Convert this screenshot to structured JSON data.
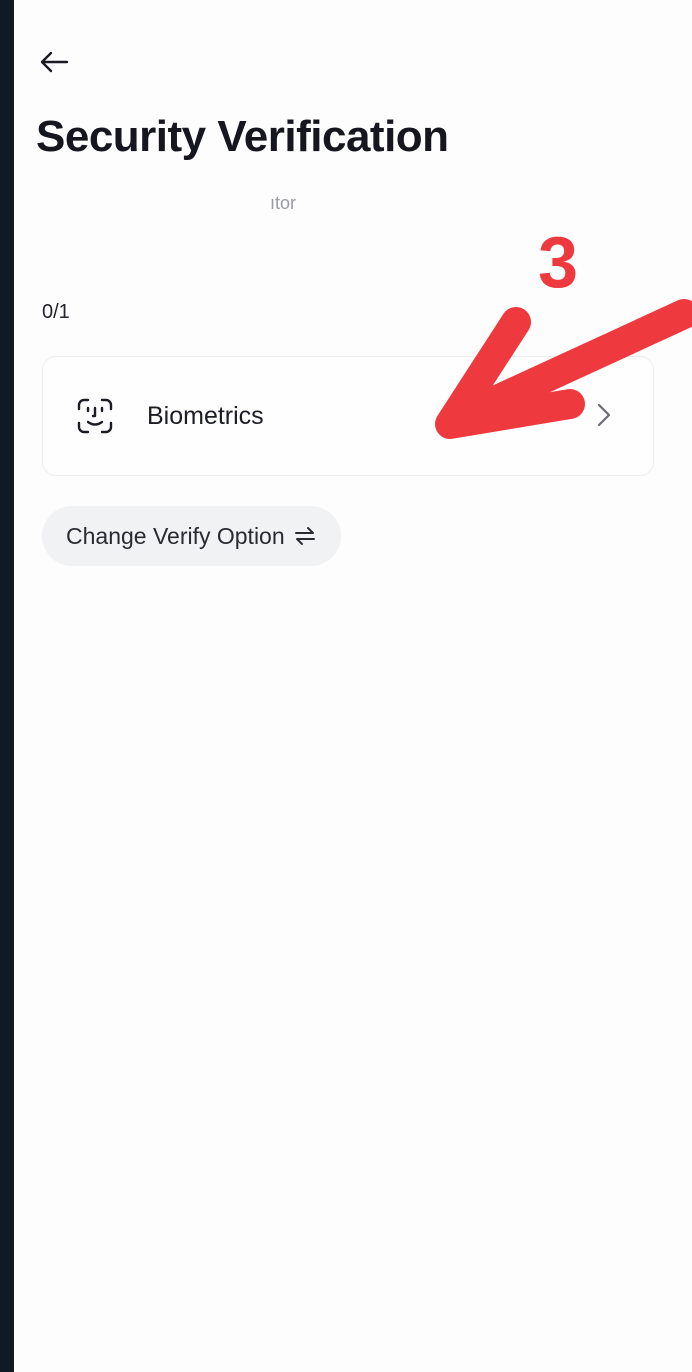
{
  "header": {
    "back_icon": "arrow-left-icon",
    "title": "Security Verification",
    "subtitle": "ıtor"
  },
  "verification": {
    "progress": "0/1",
    "options": [
      {
        "label": "Biometrics",
        "icon": "face-id-icon",
        "trailing_icon": "chevron-right-icon"
      }
    ],
    "change_option_label": "Change Verify Option",
    "change_option_icon": "swap-arrows-icon"
  },
  "annotation": {
    "step_number": "3",
    "arrow_color": "#ee3a3e"
  }
}
